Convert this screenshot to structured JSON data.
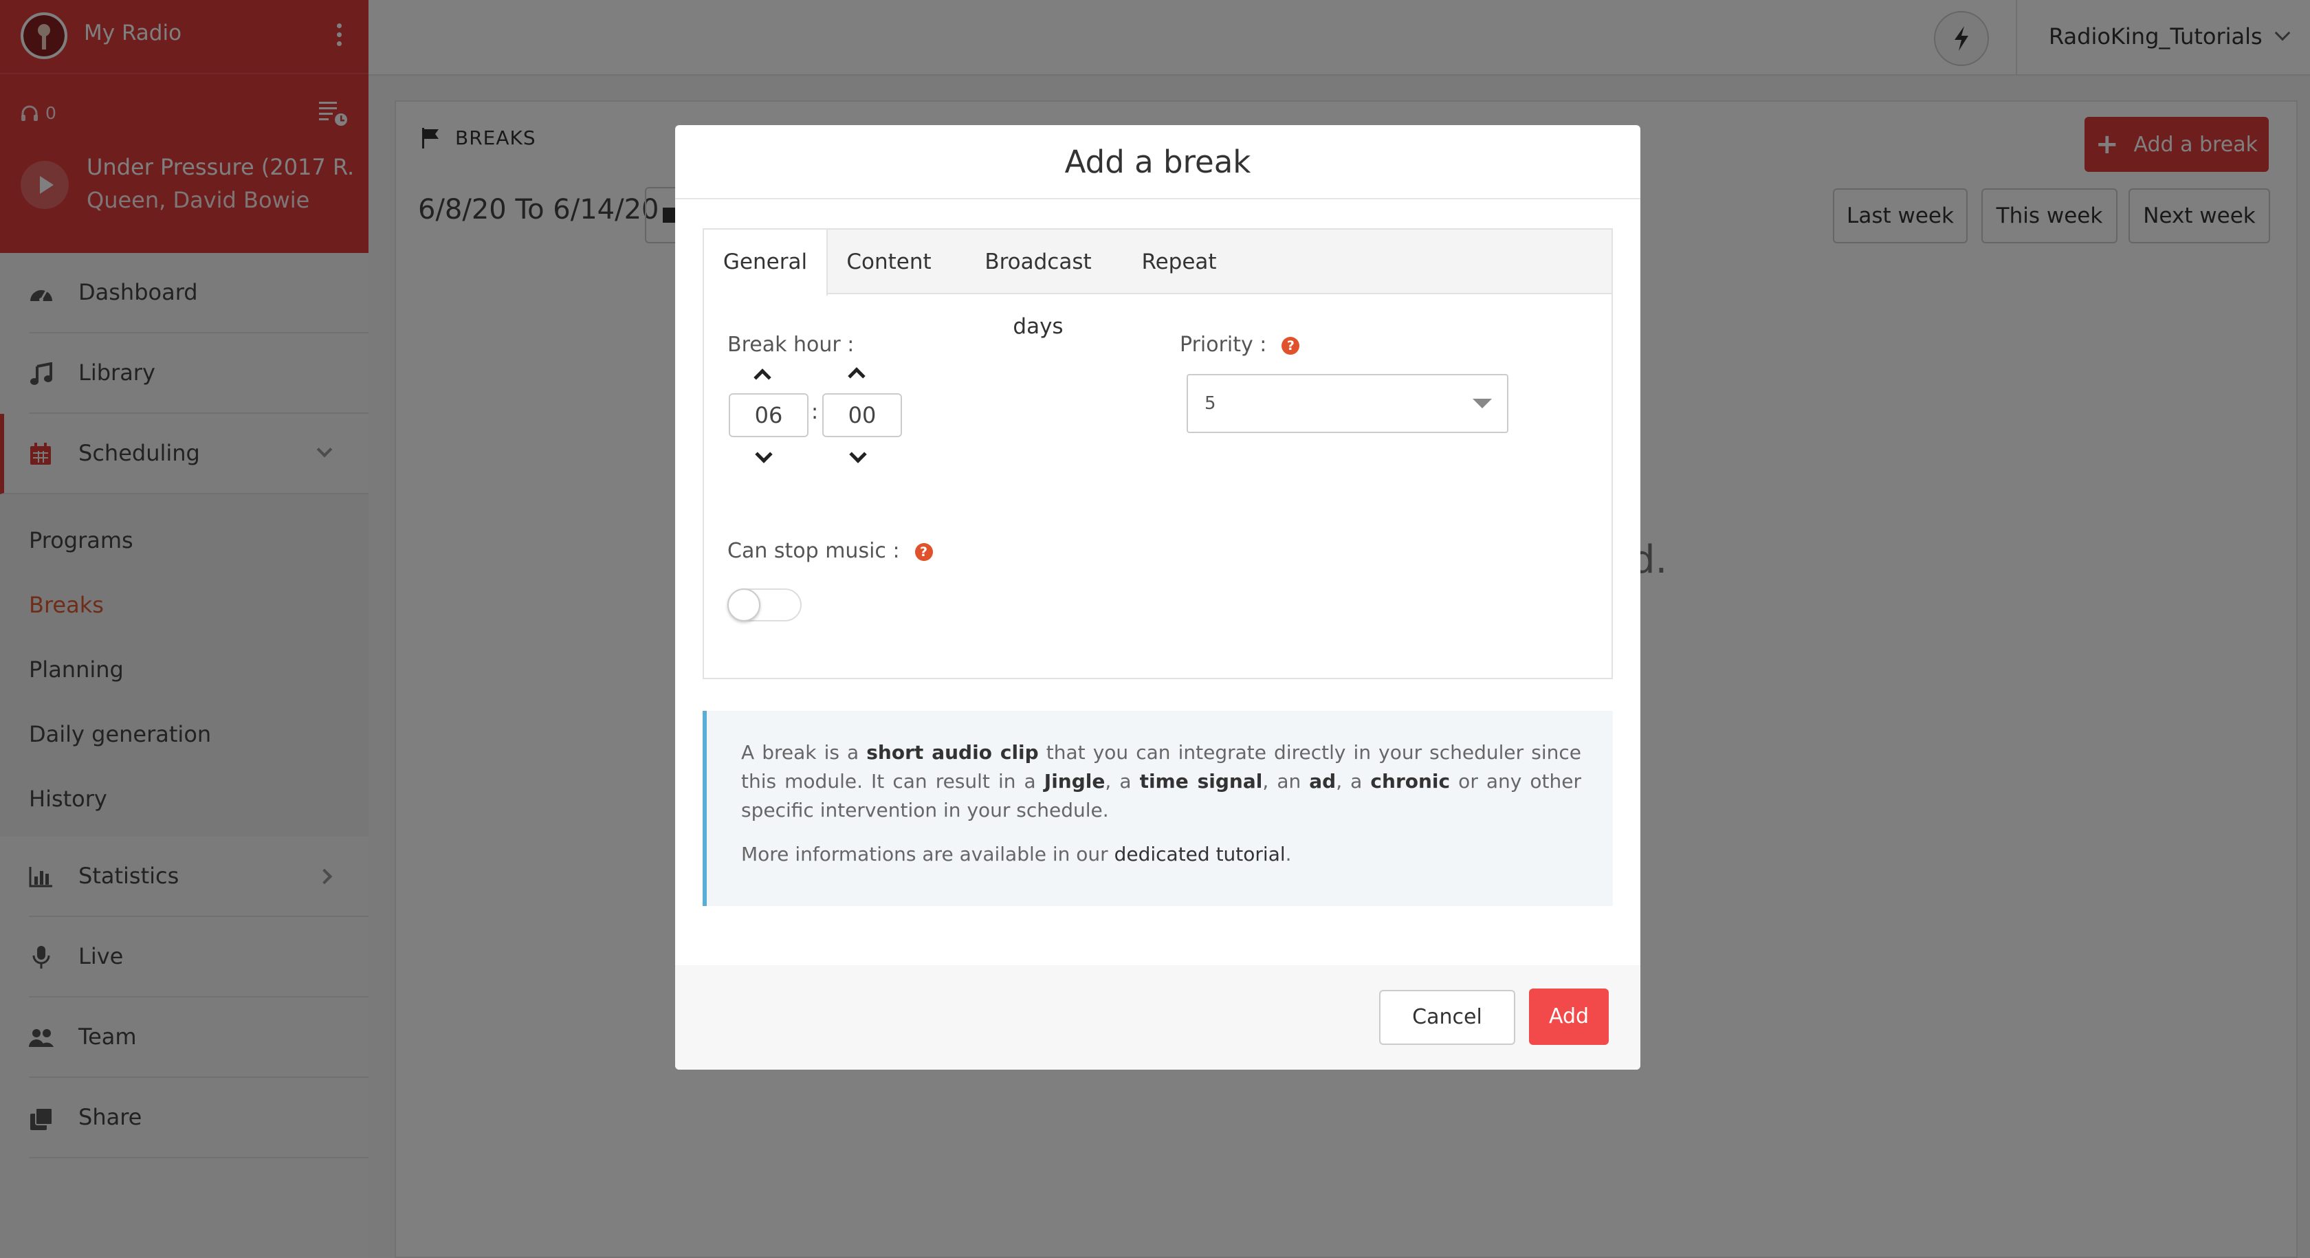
{
  "sidebar": {
    "radio_name": "My Radio",
    "listeners_count": "0",
    "now_playing": {
      "title": "Under Pressure (2017 R...",
      "artist": "Queen, David Bowie"
    },
    "nav": [
      {
        "label": "Dashboard",
        "icon": "dashboard-icon"
      },
      {
        "label": "Library",
        "icon": "music-note-icon"
      },
      {
        "label": "Scheduling",
        "icon": "calendar-icon"
      },
      {
        "label": "Statistics",
        "icon": "bar-chart-icon"
      },
      {
        "label": "Live",
        "icon": "microphone-icon"
      },
      {
        "label": "Team",
        "icon": "users-icon"
      },
      {
        "label": "Share",
        "icon": "share-icon"
      }
    ],
    "scheduling_submenu": [
      {
        "label": "Programs"
      },
      {
        "label": "Breaks",
        "current": true
      },
      {
        "label": "Planning"
      },
      {
        "label": "Daily generation"
      },
      {
        "label": "History"
      }
    ]
  },
  "topbar": {
    "username": "RadioKing_Tutorials"
  },
  "page": {
    "section_title": "BREAKS",
    "date_from": "6/8/20",
    "date_sep": "To",
    "date_to": "6/14/20",
    "add_break_label": "Add a break",
    "last_week_label": "Last week",
    "this_week_label": "This week",
    "next_week_label": "Next week",
    "empty_hint_fragment": "d."
  },
  "modal": {
    "title": "Add a break",
    "tabs": [
      "General",
      "Content",
      "Broadcast days",
      "Repeat"
    ],
    "active_tab": "General",
    "break_hour_label": "Break hour :",
    "hour_value": "06",
    "minute_value": "00",
    "time_separator": ":",
    "priority_label": "Priority :",
    "priority_value": "5",
    "can_stop_music_label": "Can stop music :",
    "can_stop_music_enabled": false,
    "help_glyph": "?",
    "info": {
      "p1_a": "A break is a ",
      "p1_b": "short audio clip",
      "p1_c": " that you can integrate directly in your scheduler since this module. It can result in a ",
      "p1_d": "Jingle",
      "p1_e": ", a ",
      "p1_f": "time signal",
      "p1_g": ", an ",
      "p1_h": "ad",
      "p1_i": ", a ",
      "p1_j": "chronic",
      "p1_k": " or any other specific intervention in your schedule.",
      "p2_a": "More informations are available in our ",
      "p2_link": "dedicated tutorial",
      "p2_b": "."
    },
    "cancel_label": "Cancel",
    "add_label": "Add"
  },
  "colors": {
    "brand_red": "#de3c3c",
    "primary_button": "#f24a4a",
    "help_icon": "#e0522b",
    "info_border": "#5aaed6",
    "active_submenu": "#de5a33"
  }
}
